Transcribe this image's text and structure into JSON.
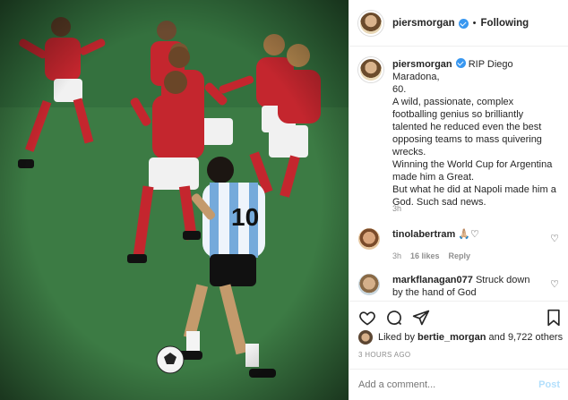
{
  "post": {
    "username": "piersmorgan",
    "separator": "•",
    "follow_label": "Following",
    "caption_lines": [
      "RIP Diego Maradona,",
      "60.",
      "A wild, passionate, complex",
      "footballing genius so brilliantly",
      "talented he reduced even the best",
      "opposing teams to mass quivering",
      "wrecks.",
      "Winning the World Cup for Argentina",
      "made him a Great.",
      "But what he did at Napoli made him a",
      "God. Such sad news."
    ],
    "caption_age": "3h"
  },
  "comments": [
    {
      "username": "tinolabertram",
      "text": "🙏🏼♡",
      "age": "3h",
      "likes": "16 likes",
      "reply": "Reply"
    },
    {
      "username": "markflanagan077",
      "text_1": "Struck down",
      "text_2": "by the hand of God"
    }
  ],
  "likes": {
    "prefix": "Liked by",
    "user": "bertie_morgan",
    "suffix": "and 9,722 others"
  },
  "posted_time": "3 HOURS AGO",
  "comment_input": {
    "placeholder": "Add a comment..."
  },
  "post_button": "Post",
  "colors": {
    "verified": "#3897f0",
    "muted": "#8e8e8e",
    "post_disabled": "#b2dffc",
    "belgium_red": "#c4262e",
    "argentina_blue": "#75aadb"
  },
  "icons": [
    "verified-icon",
    "heart-icon",
    "comment-icon",
    "share-icon",
    "bookmark-icon"
  ]
}
